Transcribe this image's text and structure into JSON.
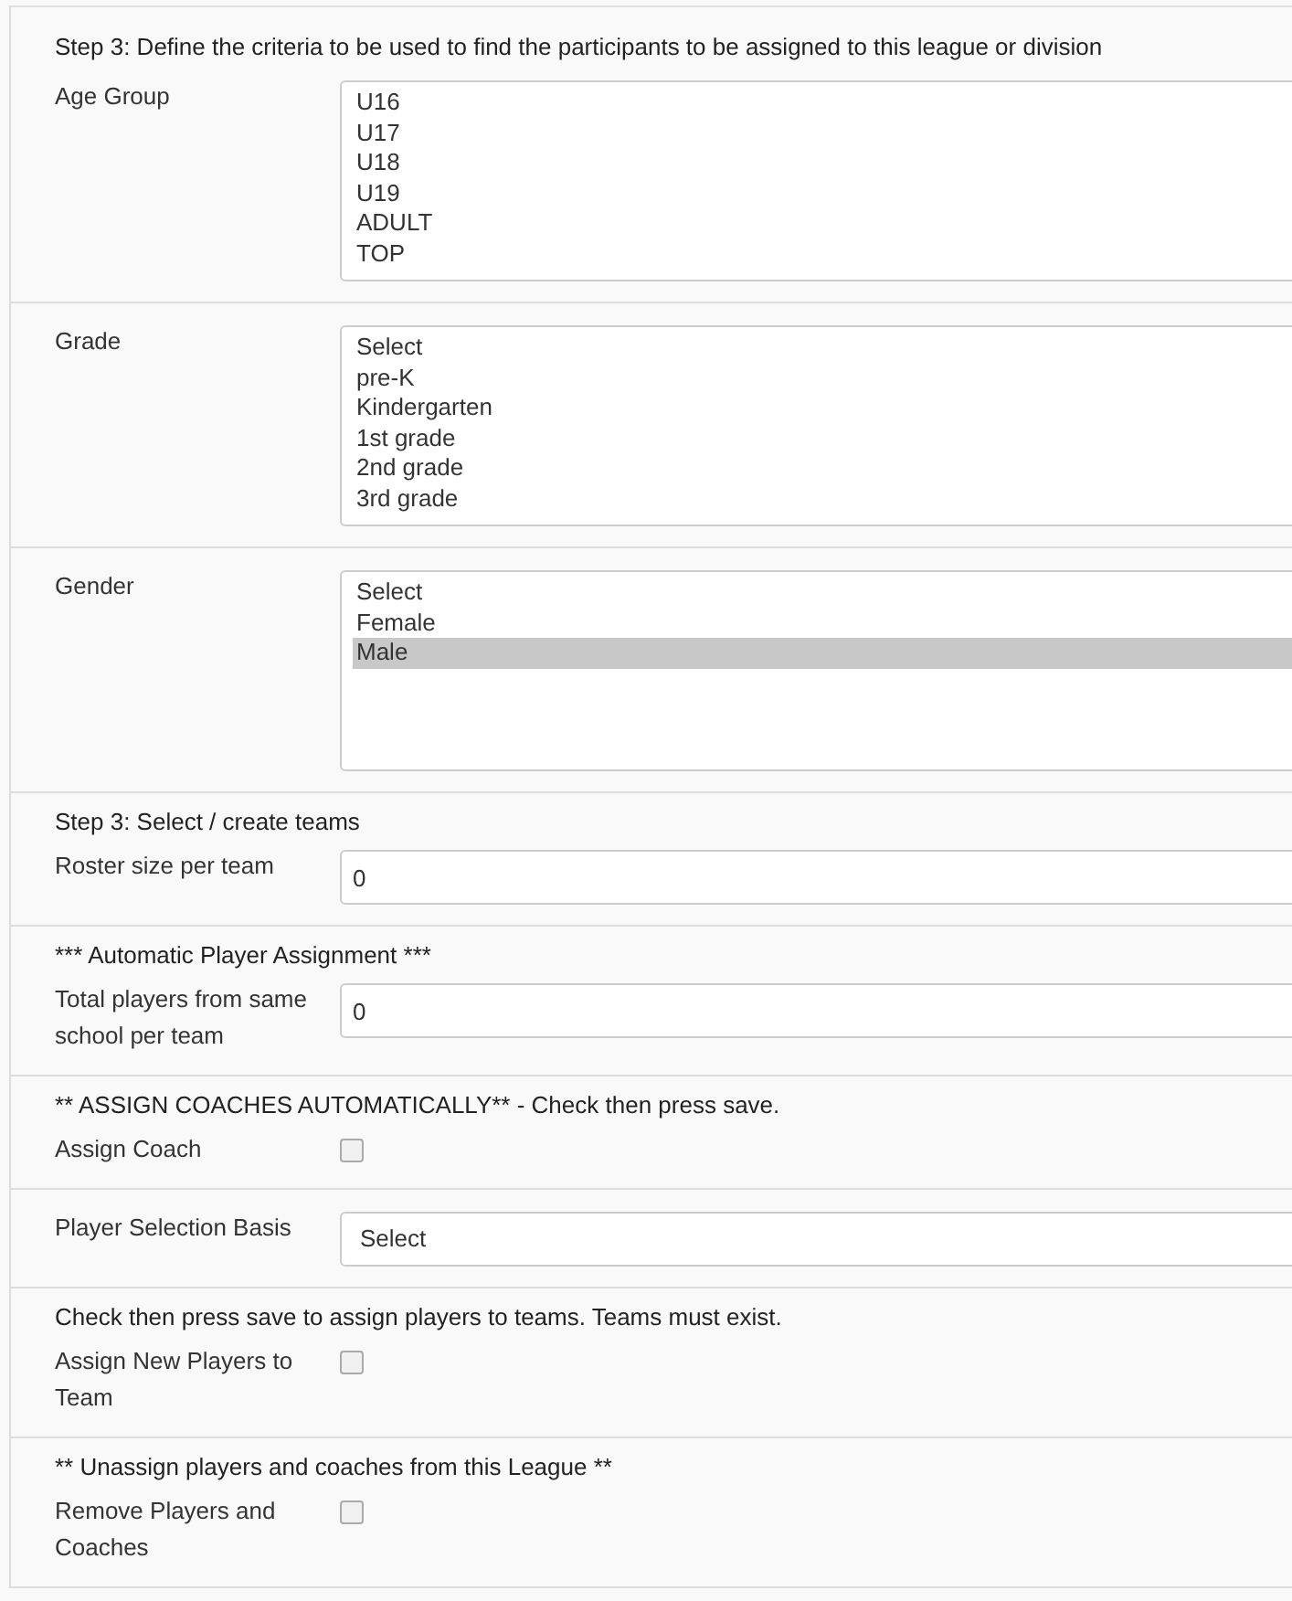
{
  "sections": [
    {
      "heading": "Step 3: Define the criteria to be used to find the participants to be assigned to this league or division",
      "fields": [
        {
          "label": "Age Group",
          "kind": "listbox",
          "options": [
            {
              "text": "U16",
              "selected": false
            },
            {
              "text": "U17",
              "selected": false
            },
            {
              "text": "U18",
              "selected": false
            },
            {
              "text": "U19",
              "selected": false
            },
            {
              "text": "ADULT",
              "selected": false
            },
            {
              "text": "TOP",
              "selected": false
            }
          ]
        }
      ]
    },
    {
      "fields": [
        {
          "label": "Grade",
          "kind": "listbox",
          "options": [
            {
              "text": "Select",
              "selected": false
            },
            {
              "text": "pre-K",
              "selected": false
            },
            {
              "text": "Kindergarten",
              "selected": false
            },
            {
              "text": "1st grade",
              "selected": false
            },
            {
              "text": "2nd grade",
              "selected": false
            },
            {
              "text": "3rd grade",
              "selected": false
            }
          ]
        }
      ]
    },
    {
      "fields": [
        {
          "label": "Gender",
          "kind": "listbox",
          "options": [
            {
              "text": "Select",
              "selected": false
            },
            {
              "text": "Female",
              "selected": false
            },
            {
              "text": "Male",
              "selected": true
            }
          ]
        }
      ]
    },
    {
      "heading": "Step 3: Select / create teams",
      "fields": [
        {
          "label": "Roster size per team",
          "kind": "input",
          "value": "0"
        }
      ]
    },
    {
      "heading": "*** Automatic Player Assignment ***",
      "fields": [
        {
          "label": "Total players from same school per team",
          "kind": "input",
          "value": "0"
        }
      ]
    },
    {
      "heading": "** ASSIGN COACHES AUTOMATICALLY** - Check then press save.",
      "fields": [
        {
          "label": "Assign Coach",
          "kind": "checkbox",
          "checked": false
        }
      ]
    },
    {
      "fields": [
        {
          "label": "Player Selection Basis",
          "kind": "select",
          "value": "Select"
        }
      ]
    },
    {
      "heading": "Check then press save to assign players to teams. Teams must exist.",
      "fields": [
        {
          "label": "Assign New Players to Team",
          "kind": "checkbox",
          "checked": false
        }
      ]
    },
    {
      "heading": "** Unassign players and coaches from this League **",
      "fields": [
        {
          "label": "Remove Players and Coaches",
          "kind": "checkbox",
          "checked": false
        }
      ]
    }
  ]
}
